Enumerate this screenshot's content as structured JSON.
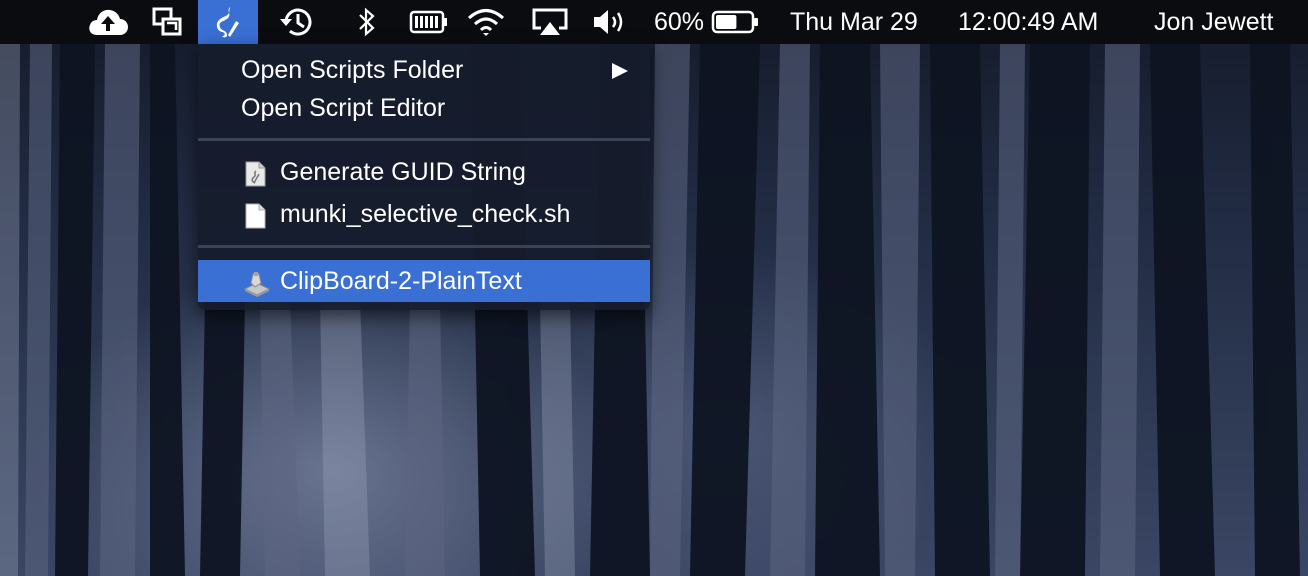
{
  "menubar": {
    "status_icons": [
      "cloud-upload-icon",
      "display-mirroring-icon",
      "scripts-menu-icon",
      "time-machine-icon",
      "bluetooth-icon",
      "battery-device-icon",
      "wifi-icon",
      "airplay-icon",
      "volume-icon",
      "battery-icon"
    ],
    "battery_percent": "60%",
    "battery_level": 0.6,
    "date": "Thu Mar 29",
    "time": "12:00:49 AM",
    "user": "Jon Jewett",
    "active_color": "#3a6fd4"
  },
  "scripts_menu": {
    "items": [
      {
        "label": "Open Scripts Folder",
        "has_submenu": true
      },
      {
        "label": "Open Script Editor"
      },
      {
        "label": "Generate GUID String",
        "icon": "script-document-icon"
      },
      {
        "label": "munki_selective_check.sh",
        "icon": "document-icon"
      },
      {
        "label": "ClipBoard-2-PlainText",
        "icon": "automator-workflow-icon",
        "selected": true
      }
    ]
  }
}
